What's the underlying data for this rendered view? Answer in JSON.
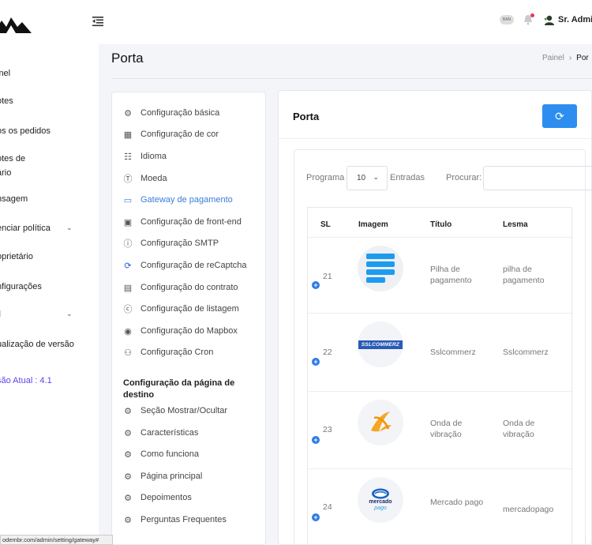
{
  "sidebar": {
    "items": [
      {
        "label": "inel"
      },
      {
        "label": "otes"
      },
      {
        "label": "os os pedidos"
      },
      {
        "label": "otes de"
      },
      {
        "label": "ário"
      },
      {
        "label": "nsagem"
      },
      {
        "label": "enciar política"
      },
      {
        "label": "oprietário"
      },
      {
        "label": "nfigurações"
      },
      {
        "label": "il"
      },
      {
        "label": "ualização de versão"
      }
    ],
    "version": "são Atual : 4.1"
  },
  "topbar": {
    "flag_text": "BAN",
    "username": "Sr. Admir"
  },
  "page": {
    "title": "Porta",
    "breadcrumb_home": "Painel",
    "breadcrumb_sep": "›",
    "breadcrumb_current": "Por"
  },
  "settings_menu": {
    "items": [
      {
        "label": "Configuração básica",
        "icon": "gear-icon"
      },
      {
        "label": "Configuração de cor",
        "icon": "palette-icon"
      },
      {
        "label": "Idioma",
        "icon": "translate-icon"
      },
      {
        "label": "Moeda",
        "icon": "dollar-icon"
      },
      {
        "label": "Gateway de pagamento",
        "icon": "card-icon"
      },
      {
        "label": "Configuração de front-end",
        "icon": "monitor-icon"
      },
      {
        "label": "Configuração SMTP",
        "icon": "info-icon"
      },
      {
        "label": "Configuração de reCaptcha",
        "icon": "recaptcha-icon"
      },
      {
        "label": "Configuração do contrato",
        "icon": "contract-icon"
      },
      {
        "label": "Configuração de listagem",
        "icon": "listing-icon"
      },
      {
        "label": "Configuração do Mapbox",
        "icon": "map-pin-icon"
      },
      {
        "label": "Configuração Cron",
        "icon": "cron-icon"
      }
    ],
    "landing_heading": "Configuração da página de destino",
    "landing_items": [
      {
        "label": "Seção Mostrar/Ocultar",
        "icon": "gear-icon"
      },
      {
        "label": "Características",
        "icon": "gear-icon"
      },
      {
        "label": "Como funciona",
        "icon": "gear-icon"
      },
      {
        "label": "Página principal",
        "icon": "gear-icon"
      },
      {
        "label": "Depoimentos",
        "icon": "gear-icon"
      },
      {
        "label": "Perguntas Frequentes",
        "icon": "gear-icon"
      }
    ]
  },
  "gateway_card": {
    "title": "Porta",
    "show_label": "Programa",
    "entries_value": "10",
    "entries_label": "Entradas",
    "search_label": "Procurar:",
    "search_value": "",
    "columns": [
      "SL",
      "Imagem",
      "Título",
      "Lesma"
    ],
    "rows": [
      {
        "sl": "21",
        "titulo": "Pilha de pagamento",
        "lesma": "pilha de pagamento",
        "logo": "stack-logo"
      },
      {
        "sl": "22",
        "titulo": "Sslcommerz",
        "lesma": "Sslcommerz",
        "logo": "sslcommerz-logo",
        "logo_text": "SSLCOMMERZ"
      },
      {
        "sl": "23",
        "titulo": "Onda de vibração",
        "lesma": "Onda de vibração",
        "logo": "vibration-logo"
      },
      {
        "sl": "24",
        "titulo": "Mercado pago",
        "lesma": "mercadopago",
        "logo": "mercadopago-logo",
        "logo_text": [
          "mercado",
          "pago"
        ]
      }
    ]
  },
  "status_bar": {
    "url": "odembr.com/admin/setting/gateway#"
  },
  "colors": {
    "primary": "#2d8ef0",
    "active_menu": "#3b7dd8",
    "version": "#5b46e8"
  }
}
